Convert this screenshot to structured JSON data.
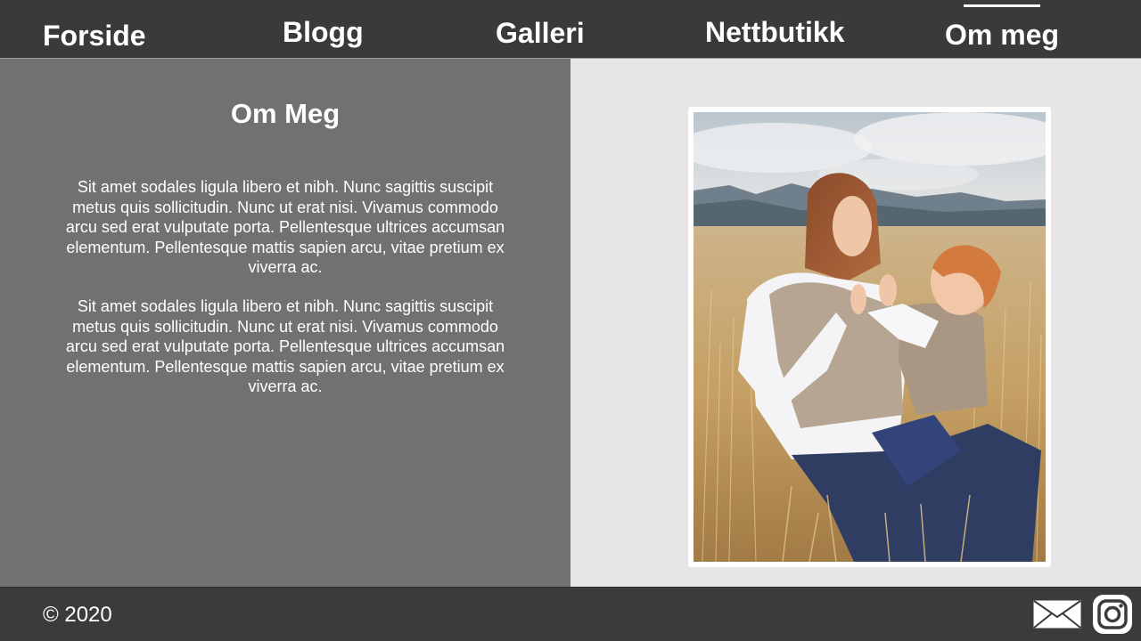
{
  "nav": {
    "items": [
      {
        "label": "Forside",
        "active": false
      },
      {
        "label": "Blogg",
        "active": false
      },
      {
        "label": "Galleri",
        "active": false
      },
      {
        "label": "Nettbutikk",
        "active": false
      },
      {
        "label": "Om meg",
        "active": true
      }
    ]
  },
  "main": {
    "title": "Om Meg",
    "paragraphs": [
      "Sit amet sodales ligula libero et nibh. Nunc sagittis suscipit metus quis sollicitudin. Nunc ut erat nisi. Vivamus commodo arcu sed erat vulputate porta. Pellentesque ultrices accumsan elementum. Pellentesque mattis sapien arcu, vitae pretium ex viverra ac.",
      "Sit amet sodales ligula libero et nibh. Nunc sagittis suscipit metus quis sollicitudin. Nunc ut erat nisi. Vivamus commodo arcu sed erat vulputate porta. Pellentesque ultrices accumsan elementum. Pellentesque mattis sapien arcu, vitae pretium ex viverra ac."
    ],
    "photo": {
      "icon": "photo-mother-and-child-in-wheat-field"
    }
  },
  "footer": {
    "copyright": "© 2020",
    "icons": [
      "mail-icon",
      "instagram-icon"
    ]
  },
  "colors": {
    "nav_bg": "#3a3a3a",
    "left_panel": "#717171",
    "right_panel": "#e7e5e6",
    "footer_bg": "#3b3b3b",
    "text": "#ffffff"
  }
}
